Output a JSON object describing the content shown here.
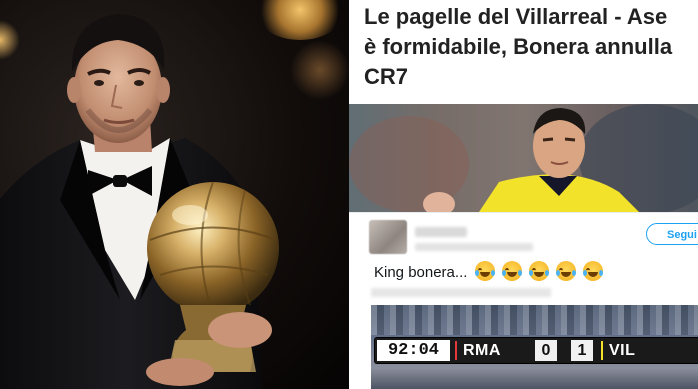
{
  "headline": {
    "text": "Le pagelle del Villarreal - Ase\nè formidabile, Bonera annulla\nCR7"
  },
  "tweet": {
    "follow_label": "Segui",
    "text": "King bonera... ",
    "emoji_count": 5,
    "emoji_icon": "face-with-tears-of-joy-icon"
  },
  "scoreboard": {
    "time": "92:04",
    "home_team": "RMA",
    "home_score": "0",
    "away_score": "1",
    "away_team": "VIL"
  },
  "colors": {
    "accent": "#1da1f2",
    "headline_text": "#222222"
  }
}
